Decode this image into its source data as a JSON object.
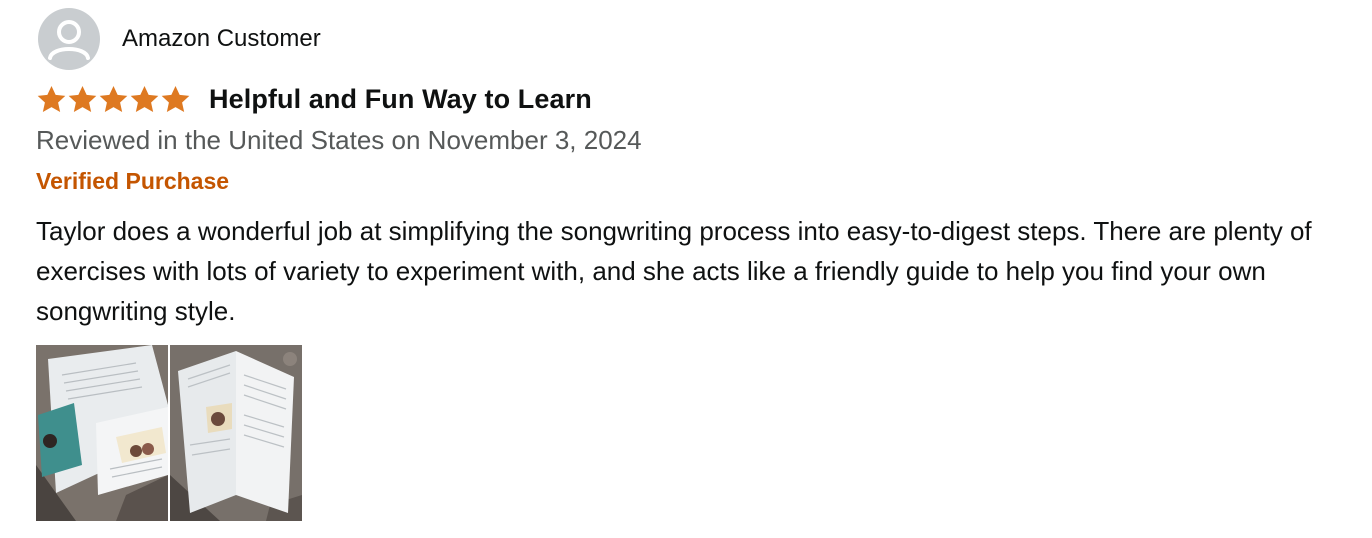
{
  "profile": {
    "name": "Amazon Customer",
    "avatar_icon": "user-silhouette-icon"
  },
  "rating": {
    "stars": 5,
    "max": 5,
    "star_color": "#de7921",
    "icon": "star-icon"
  },
  "review": {
    "title": "Helpful and Fun Way to Learn",
    "date": "Reviewed in the United States on November 3, 2024",
    "verified": "Verified Purchase",
    "body": "Taylor does a wonderful job at simplifying the songwriting process into easy-to-digest steps. There are plenty of exercises with lots of variety to experiment with, and she acts like a friendly guide to help you find your own songwriting style."
  },
  "images": [
    {
      "name": "review-image-1"
    },
    {
      "name": "review-image-2"
    }
  ],
  "colors": {
    "verified": "#c45500",
    "muted_text": "#565959",
    "text": "#0f1111"
  }
}
